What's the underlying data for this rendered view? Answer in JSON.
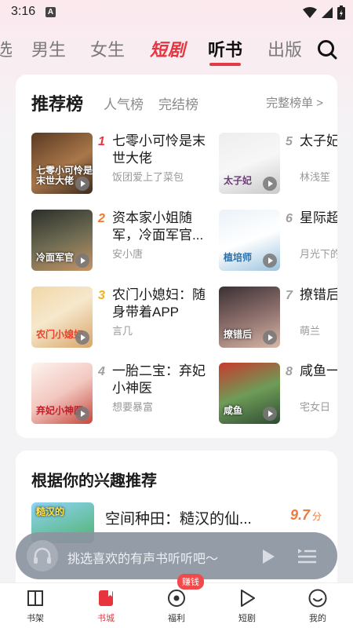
{
  "status": {
    "time": "3:16",
    "notif_letter": "A"
  },
  "topnav": {
    "tabs": [
      {
        "label": "选"
      },
      {
        "label": "男生"
      },
      {
        "label": "女生"
      },
      {
        "label": "短剧"
      },
      {
        "label": "听书"
      },
      {
        "label": "出版"
      }
    ],
    "active_tab": "听书"
  },
  "ranking": {
    "title": "推荐榜",
    "tabs": [
      "人气榜",
      "完结榜"
    ],
    "more": "完整榜单 >",
    "books": [
      {
        "rank": "1",
        "title": "七零小可怜是末世大佬",
        "author": "饭团爱上了菜包",
        "cover_text": "七零小可怜是末世大佬"
      },
      {
        "rank": "2",
        "title": "资本家小姐随军，冷面军官...",
        "author": "安小唐",
        "cover_text": "冷面军官"
      },
      {
        "rank": "3",
        "title": "农门小媳妇：随身带着APP",
        "author": "言几",
        "cover_text": "农门小媳妇"
      },
      {
        "rank": "4",
        "title": "一胎二宝：弃妃小神医",
        "author": "想要暴富",
        "cover_text": "弃妃小神医"
      },
      {
        "rank": "5",
        "title": "太子妃佬",
        "author": "林浅笙",
        "cover_text": "太子妃"
      },
      {
        "rank": "6",
        "title": "星际超",
        "author": "月光下的",
        "cover_text": "植培师"
      },
      {
        "rank": "7",
        "title": "撩错后男小叔",
        "author": "萌兰",
        "cover_text": "撩错后"
      },
      {
        "rank": "8",
        "title": "咸鱼一生活",
        "author": "宅女日",
        "cover_text": "咸鱼"
      }
    ]
  },
  "interest": {
    "title": "根据你的兴趣推荐",
    "book": {
      "title": "空间种田：糙汉的仙...",
      "score": "9.7",
      "score_unit": "分",
      "cover_text": "糙汉的"
    }
  },
  "player": {
    "placeholder": "挑选喜欢的有声书听听吧～"
  },
  "bottom_nav": {
    "items": [
      {
        "label": "书架",
        "icon": "bookshelf-icon"
      },
      {
        "label": "书城",
        "icon": "bookstore-icon"
      },
      {
        "label": "福利",
        "icon": "welfare-icon"
      },
      {
        "label": "短剧",
        "icon": "drama-play-icon"
      },
      {
        "label": "我的",
        "icon": "profile-smile-icon"
      }
    ],
    "active": "书城",
    "badge": "赚钱"
  },
  "colors": {
    "accent": "#e8343f",
    "rank_1": "#e8343f",
    "rank_2": "#f07a2a",
    "rank_3": "#f0b020",
    "rank_other": "#a0a0a0",
    "score": "#ef7a3a"
  }
}
